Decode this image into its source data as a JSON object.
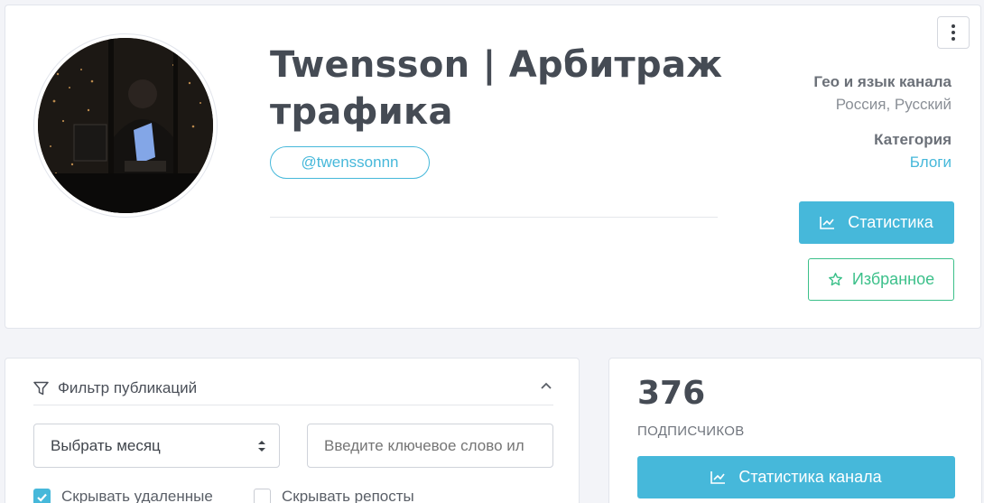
{
  "profile": {
    "title": "Twensson | Арбитраж трафика",
    "handle": "@twenssonnn",
    "geo_label": "Гео и язык канала",
    "geo_value": "Россия, Русский",
    "category_label": "Категория",
    "category_value": "Блоги",
    "stats_button": "Статистика",
    "favorite_button": "Избранное",
    "menu_icon": "kebab-menu-icon"
  },
  "filter": {
    "title": "Фильтр публикаций",
    "month_select": "Выбрать месяц",
    "keyword_placeholder": "Введите ключевое слово ил",
    "hide_deleted": "Скрывать удаленные",
    "hide_deleted_checked": true,
    "hide_reposts": "Скрывать репосты",
    "hide_reposts_checked": false
  },
  "stats": {
    "subscribers_count": "376",
    "subscribers_label": "ПОДПИСЧИКОВ",
    "channel_stats_button": "Статистика канала"
  },
  "colors": {
    "accent": "#46b8da",
    "success": "#3cc08a",
    "background": "#f3f4f8"
  }
}
